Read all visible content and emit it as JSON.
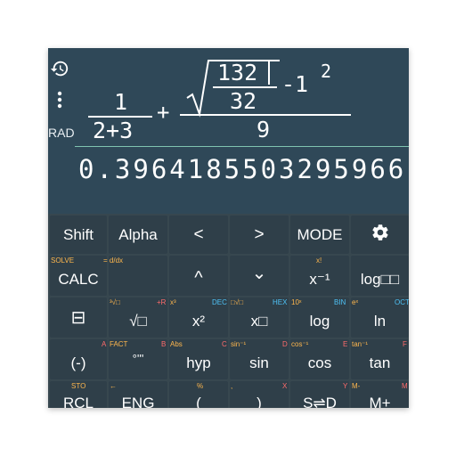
{
  "display": {
    "angle_mode": "RAD",
    "expression": {
      "frac1_num": "1",
      "frac1_den": "2+3",
      "plus": "+",
      "radical_num": "132",
      "radical_den": "32",
      "minus_one": "-1",
      "exponent": "2",
      "big_den": "9"
    },
    "result": "0.3964185503295966"
  },
  "keypad": {
    "row1": [
      "Shift",
      "Alpha",
      "<",
      ">",
      "MODE"
    ],
    "row2": {
      "calc": "CALC",
      "calc_shift": "SOLVE",
      "calc_alpha": "= d/dx",
      "up": "^",
      "down": "⌄",
      "inverse": "x⁻¹",
      "inverse_shift": "x!",
      "log_base": "log□□"
    },
    "row3": {
      "frac": "⊟",
      "sqrt": "√□",
      "sqrt_shift": "³√□",
      "sqrt_alpha": "+R",
      "square": "x²",
      "square_shift": "x³",
      "square_alpha": "DEC",
      "power": "x□",
      "power_shift": "□√□",
      "power_alpha": "HEX",
      "log": "log",
      "log_shift": "10ˣ",
      "log_alpha": "BIN",
      "ln": "ln",
      "ln_shift": "eˣ",
      "ln_alpha": "OCT"
    },
    "row4": {
      "neg": "(-)",
      "neg_alpha": "A",
      "deg": "°'''",
      "deg_shift": "FACT",
      "deg_alpha": "B",
      "hyp": "hyp",
      "hyp_shift": "Abs",
      "hyp_alpha": "C",
      "sin": "sin",
      "sin_shift": "sin⁻¹",
      "sin_alpha": "D",
      "cos": "cos",
      "cos_shift": "cos⁻¹",
      "cos_alpha": "E",
      "tan": "tan",
      "tan_shift": "tan⁻¹",
      "tan_alpha": "F"
    },
    "row5": {
      "rcl": "RCL",
      "rcl_shift": "STO",
      "eng": "ENG",
      "eng_shift": "←",
      "lparen": "(",
      "lparen_shift": "%",
      "rparen": ")",
      "rparen_shift": ",",
      "rparen_alpha": "X",
      "sd": "S⇌D",
      "sd_alpha": "Y",
      "mplus": "M+",
      "mplus_shift": "M-",
      "mplus_alpha": "M"
    }
  }
}
